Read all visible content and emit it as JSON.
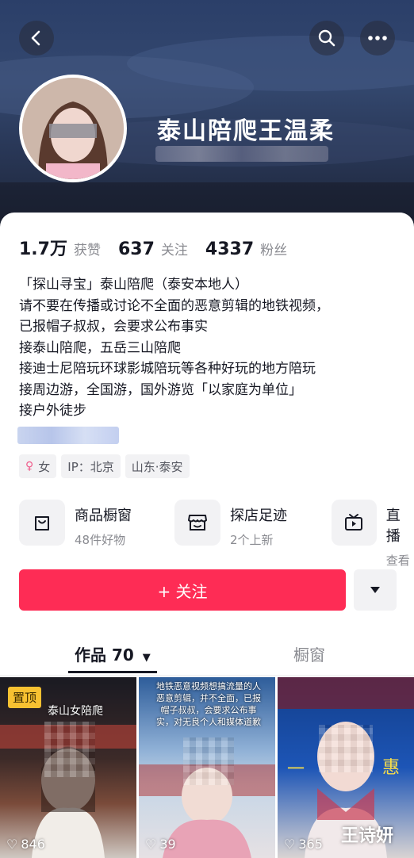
{
  "header": {
    "back_icon": "back-arrow-icon",
    "search_icon": "search-icon",
    "more_icon": "more-dots-icon",
    "username": "泰山陪爬王温柔"
  },
  "stats": [
    {
      "num": "1.7万",
      "label": "获赞"
    },
    {
      "num": "637",
      "label": "关注"
    },
    {
      "num": "4337",
      "label": "粉丝"
    }
  ],
  "bio": [
    "「探山寻宝」泰山陪爬（泰安本地人）",
    "请不要在传播或讨论不全面的恶意剪辑的地铁视频，",
    "已报帽子叔叔，会要求公布事实",
    "接泰山陪爬，五岳三山陪爬",
    "接迪士尼陪玩环球影城陪玩等各种好玩的地方陪玩",
    "接周边游，全国游，国外游览「以家庭为单位」",
    "接户外徒步"
  ],
  "tags": {
    "gender": "女",
    "ip": "IP：北京",
    "location": "山东·泰安"
  },
  "features": [
    {
      "title": "商品橱窗",
      "sub": "48件好物",
      "icon": "shopping-bag-icon"
    },
    {
      "title": "探店足迹",
      "sub": "2个上新",
      "icon": "store-icon"
    },
    {
      "title": "直播",
      "sub": "查看",
      "icon": "tv-icon"
    }
  ],
  "actions": {
    "follow": "+ 关注",
    "dropdown_icon": "caret-down-icon"
  },
  "tabs": {
    "works": "作品 70",
    "showcase": "橱窗"
  },
  "videos": [
    {
      "likes": "846",
      "pinned": "置顶",
      "caption": "泰山女陪爬"
    },
    {
      "likes": "39",
      "caption": "地铁恶意视频想搞流量的人恶意剪辑，并不全面，已报帽子叔叔，会要求公布事实，对无良个人和媒体道歉"
    },
    {
      "likes": "365",
      "caption_left": "一",
      "caption_right": "惠"
    }
  ],
  "watermark": "王诗妍",
  "colors": {
    "accent": "#fe2c55",
    "pin": "#f7c131"
  }
}
